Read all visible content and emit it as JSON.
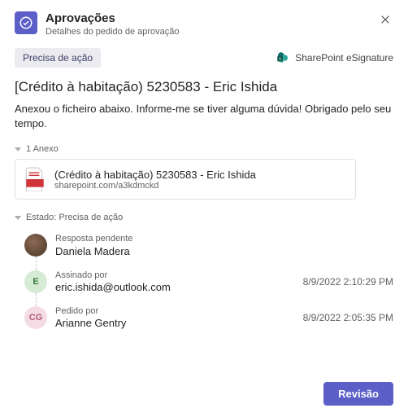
{
  "header": {
    "title": "Aprovações",
    "subtitle": "Detalhes do pedido de aprovação"
  },
  "status": {
    "pill": "Precisa de ação",
    "integration": "SharePoint eSignature"
  },
  "request": {
    "subject": "[Crédito à habitação) 5230583 - Eric Ishida",
    "body": "Anexou o ficheiro abaixo. Informe-me se tiver alguma dúvida! Obrigado pelo seu tempo."
  },
  "attachments": {
    "label": "1 Anexo",
    "items": [
      {
        "name": "(Crédito à habitação) 5230583 - Eric Ishida",
        "url": "sharepoint.com/a3kdmckd"
      }
    ]
  },
  "state": {
    "label": "Estado: Precisa de ação"
  },
  "timeline": [
    {
      "caption": "Resposta pendente",
      "name": "Daniela Madera",
      "initials": "",
      "avatar": "photo",
      "timestamp": ""
    },
    {
      "caption": "Assinado por",
      "name": "eric.ishida@outlook.com",
      "initials": "E",
      "avatar": "e",
      "timestamp": "8/9/2022 2:10:29 PM"
    },
    {
      "caption": "Pedido por",
      "name": "Arianne Gentry",
      "initials": "CG",
      "avatar": "cg",
      "timestamp": "8/9/2022 2:05:35 PM"
    }
  ],
  "actions": {
    "primary": "Revisão"
  }
}
